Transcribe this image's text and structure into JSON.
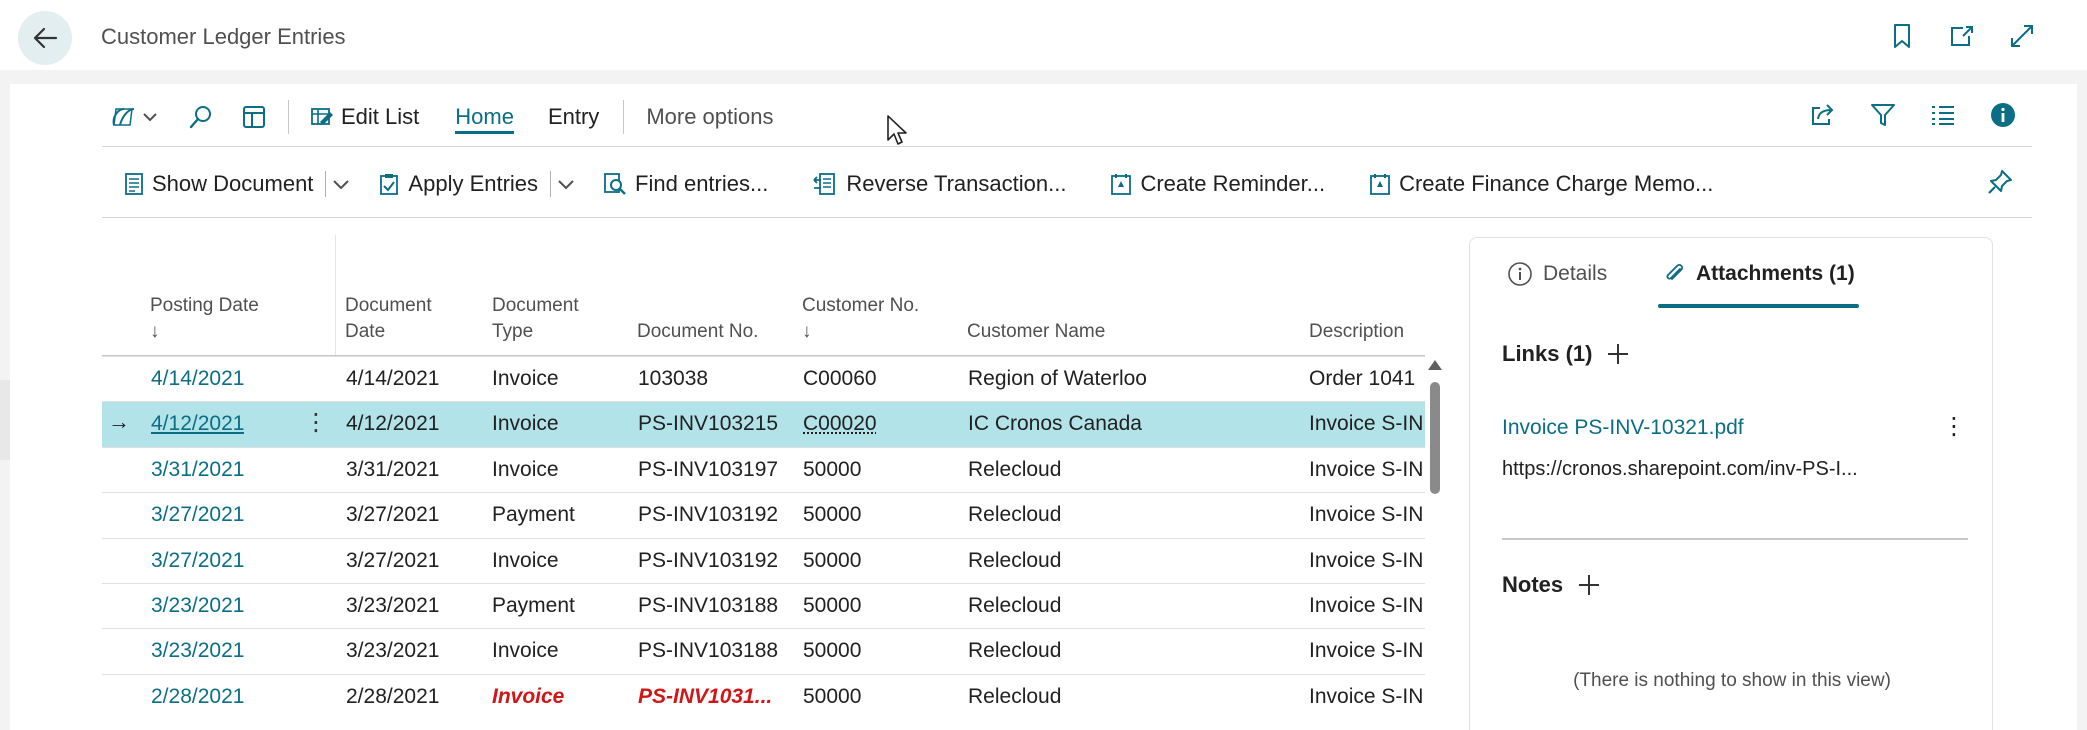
{
  "page": {
    "title": "Customer Ledger Entries"
  },
  "actionbar": {
    "edit_list": "Edit List",
    "tab_home": "Home",
    "tab_entry": "Entry",
    "more_options": "More options"
  },
  "commands": {
    "show_document": "Show Document",
    "apply_entries": "Apply Entries",
    "find_entries": "Find entries...",
    "reverse_transaction": "Reverse Transaction...",
    "create_reminder": "Create Reminder...",
    "create_finance_charge_memo": "Create Finance Charge Memo..."
  },
  "table": {
    "headers": {
      "posting_date_1": "Posting Date",
      "posting_date_2": "↓",
      "document_date_1": "Document",
      "document_date_2": "Date",
      "document_type_1": "Document",
      "document_type_2": "Type",
      "document_no": "Document No.",
      "customer_no_1": "Customer No.",
      "customer_no_2": "↓",
      "customer_name": "Customer Name",
      "description": "Description"
    },
    "rows": [
      {
        "posting_date": "4/14/2021",
        "document_date": "4/14/2021",
        "document_type": "Invoice",
        "document_no": "103038",
        "customer_no": "C00060",
        "customer_name": "Region of Waterloo",
        "description": "Order 1041"
      },
      {
        "posting_date": "4/12/2021",
        "document_date": "4/12/2021",
        "document_type": "Invoice",
        "document_no": "PS-INV103215",
        "customer_no": "C00020",
        "customer_name": "IC Cronos Canada",
        "description": "Invoice S-IN"
      },
      {
        "posting_date": "3/31/2021",
        "document_date": "3/31/2021",
        "document_type": "Invoice",
        "document_no": "PS-INV103197",
        "customer_no": "50000",
        "customer_name": "Relecloud",
        "description": "Invoice S-IN"
      },
      {
        "posting_date": "3/27/2021",
        "document_date": "3/27/2021",
        "document_type": "Payment",
        "document_no": "PS-INV103192",
        "customer_no": "50000",
        "customer_name": "Relecloud",
        "description": "Invoice S-IN"
      },
      {
        "posting_date": "3/27/2021",
        "document_date": "3/27/2021",
        "document_type": "Invoice",
        "document_no": "PS-INV103192",
        "customer_no": "50000",
        "customer_name": "Relecloud",
        "description": "Invoice S-IN"
      },
      {
        "posting_date": "3/23/2021",
        "document_date": "3/23/2021",
        "document_type": "Payment",
        "document_no": "PS-INV103188",
        "customer_no": "50000",
        "customer_name": "Relecloud",
        "description": "Invoice S-IN"
      },
      {
        "posting_date": "3/23/2021",
        "document_date": "3/23/2021",
        "document_type": "Invoice",
        "document_no": "PS-INV103188",
        "customer_no": "50000",
        "customer_name": "Relecloud",
        "description": "Invoice S-IN"
      },
      {
        "posting_date": "2/28/2021",
        "document_date": "2/28/2021",
        "document_type": "Invoice",
        "document_no": "PS-INV1031...",
        "customer_no": "50000",
        "customer_name": "Relecloud",
        "description": "Invoice S-IN"
      }
    ]
  },
  "factbox": {
    "tab_details": "Details",
    "tab_attachments": "Attachments (1)",
    "links_title": "Links (1)",
    "link_name": "Invoice PS-INV-10321.pdf",
    "link_url": "https://cronos.sharepoint.com/inv-PS-I...",
    "notes_title": "Notes",
    "empty_text": "(There is nothing to show in this view)"
  },
  "colors": {
    "accent": "#0b6e85",
    "selected_row": "#b2e3e8",
    "overdue": "#d01616"
  }
}
